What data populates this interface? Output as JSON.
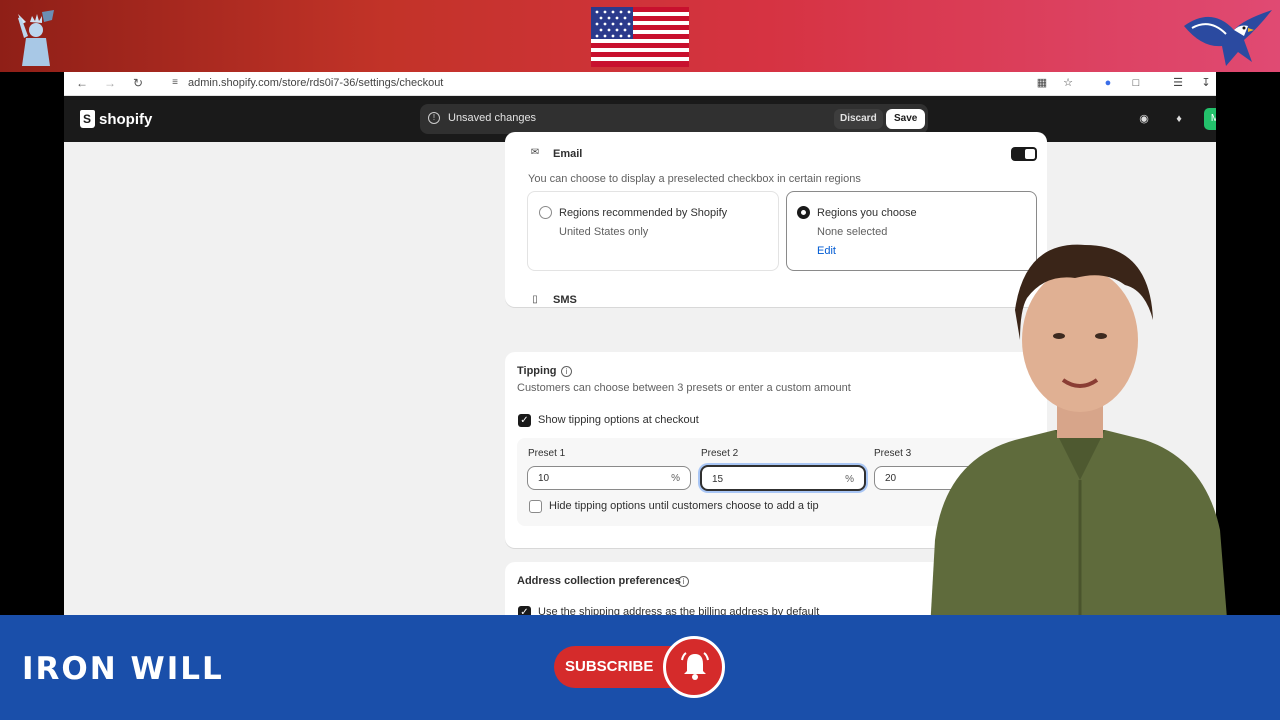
{
  "browser": {
    "url": "admin.shopify.com/store/rds0i7-36/settings/checkout"
  },
  "topbar": {
    "logo_text": "shopify",
    "unsaved_text": "Unsaved changes",
    "discard_label": "Discard",
    "save_label": "Save",
    "avatar_initial": "M"
  },
  "marketing": {
    "email_label": "Email",
    "email_description": "You can choose to display a preselected checkbox in certain regions",
    "options": [
      {
        "title": "Regions recommended by Shopify",
        "subtitle": "United States only",
        "selected": false
      },
      {
        "title": "Regions you choose",
        "subtitle": "None selected",
        "link": "Edit",
        "selected": true
      }
    ],
    "sms_label": "SMS"
  },
  "tipping": {
    "title": "Tipping",
    "description": "Customers can choose between 3 presets or enter a custom amount",
    "show_label": "Show tipping options at checkout",
    "show_checked": true,
    "presets": [
      {
        "label": "Preset 1",
        "value": "10",
        "unit": "%"
      },
      {
        "label": "Preset 2",
        "value": "15",
        "unit": "%"
      },
      {
        "label": "Preset 3",
        "value": "20",
        "unit": "%"
      }
    ],
    "hide_label": "Hide tipping options until customers choose to add a tip",
    "hide_checked": false
  },
  "address": {
    "title": "Address collection preferences",
    "billing_label": "Use the shipping address as the billing address by default"
  },
  "overlay": {
    "channel_name": "IRON WILL",
    "subscribe_label": "SUBSCRIBE"
  },
  "colors": {
    "banner_red": "#c23328",
    "banner_blue": "#1a4faa",
    "subscribe_red": "#d52b2b",
    "shopify_dark": "#1a1a1a",
    "link_blue": "#005bd3"
  }
}
